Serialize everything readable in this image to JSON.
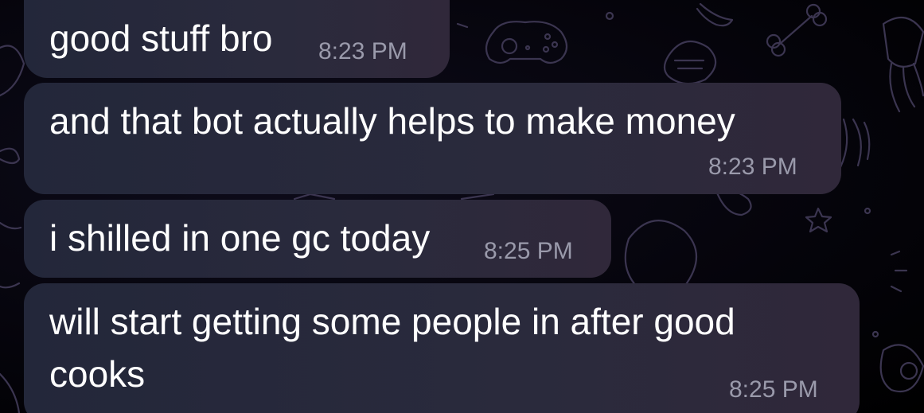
{
  "messages": [
    {
      "text": "good stuff bro",
      "time": "8:23 PM"
    },
    {
      "text": "and that bot actually helps to make money",
      "time": "8:23 PM"
    },
    {
      "text": "i shilled in one gc today",
      "time": "8:25 PM"
    },
    {
      "text_line1": "will start getting some people in after good",
      "text_line2": "cooks",
      "time": "8:25 PM"
    }
  ],
  "colors": {
    "bubble": "#26283a",
    "text": "#ffffff",
    "timestamp": "#9a9aab",
    "background": "#000000"
  },
  "background_doodles": [
    "game-controller-icon",
    "bone-icon",
    "shell-icon",
    "jellyfish-icon",
    "star-icon",
    "balloon-icon"
  ]
}
